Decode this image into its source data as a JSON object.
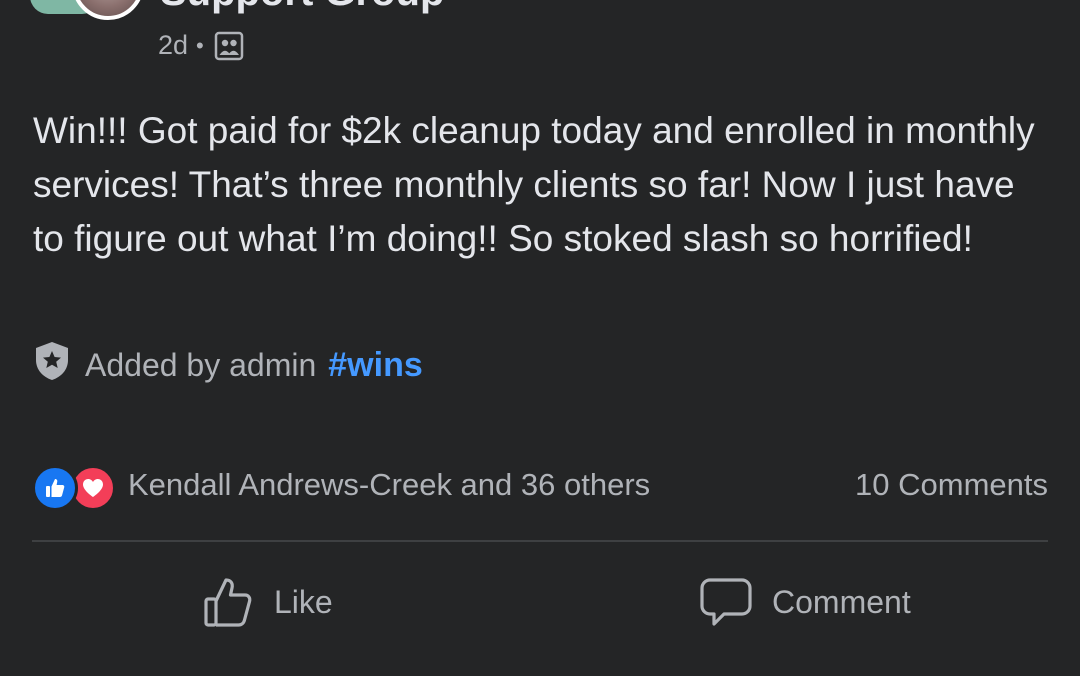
{
  "post": {
    "group_name": "Support Group",
    "timestamp": "2d",
    "separator": "•",
    "privacy_icon": "group-members-icon",
    "body": "Win!!! Got paid for $2k cleanup today and enrolled in monthly services! That’s three monthly clients so far! Now I just have to figure out what I’m doing!! So stoked slash so horrified!",
    "added_by": "Added by admin",
    "hashtag": "#wins"
  },
  "reactions": {
    "icons": [
      "like-reaction-icon",
      "love-reaction-icon"
    ],
    "summary": "Kendall Andrews-Creek and 36 others",
    "comments": "10 Comments"
  },
  "actions": {
    "like_label": "Like",
    "comment_label": "Comment"
  },
  "colors": {
    "background": "#242526",
    "text": "#e4e6eb",
    "secondary_text": "#b0b3b8",
    "hashtag": "#4599ff",
    "like_blue": "#1877f2",
    "love_red": "#f33e58"
  }
}
